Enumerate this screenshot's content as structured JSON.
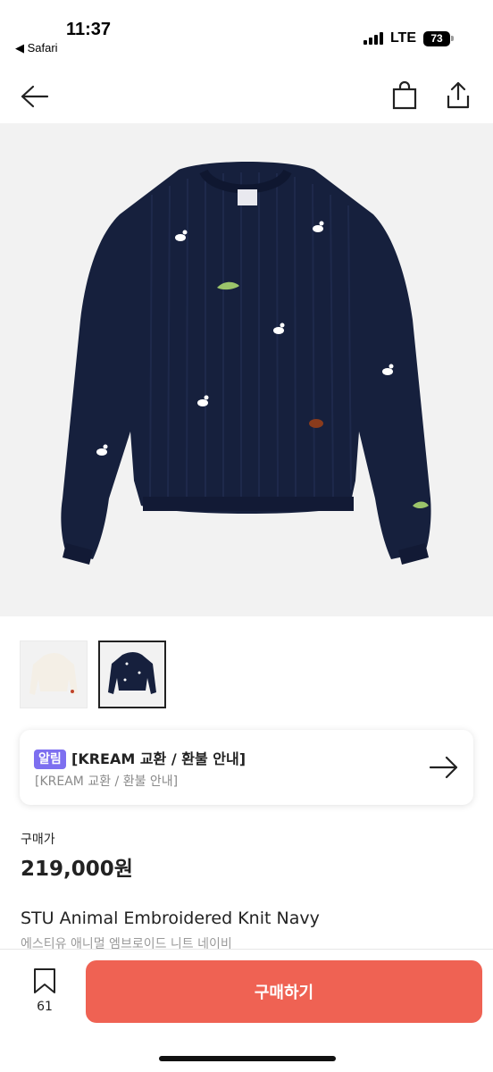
{
  "status": {
    "time": "11:37",
    "back_app": "◀ Safari",
    "network": "LTE",
    "battery": "73"
  },
  "nav": {
    "back_icon": "arrow-left-icon",
    "bag_icon": "shopping-bag-icon",
    "share_icon": "share-icon"
  },
  "product": {
    "hero_alt": "navy knit sweater with embroidered animals",
    "thumbnails": [
      {
        "color": "cream",
        "selected": false
      },
      {
        "color": "navy",
        "selected": true
      }
    ],
    "price_label": "구매가",
    "price": "219,000원",
    "name_en": "STU Animal Embroidered Knit Navy",
    "name_ko": "에스티유 애니멀 엠브로이드 니트 네이비"
  },
  "notice": {
    "tag": "알림",
    "title": "[KREAM 교환 / 환불 안내]",
    "subtitle": "[KREAM 교환 / 환불 안내]",
    "arrow_icon": "arrow-right-icon"
  },
  "bottom": {
    "wish_count": "61",
    "wish_icon": "bookmark-icon",
    "buy_label": "구매하기"
  },
  "colors": {
    "buy_button": "#ef6253",
    "tag_purple": "#7d6ff0",
    "sweater_navy": "#16203d"
  }
}
